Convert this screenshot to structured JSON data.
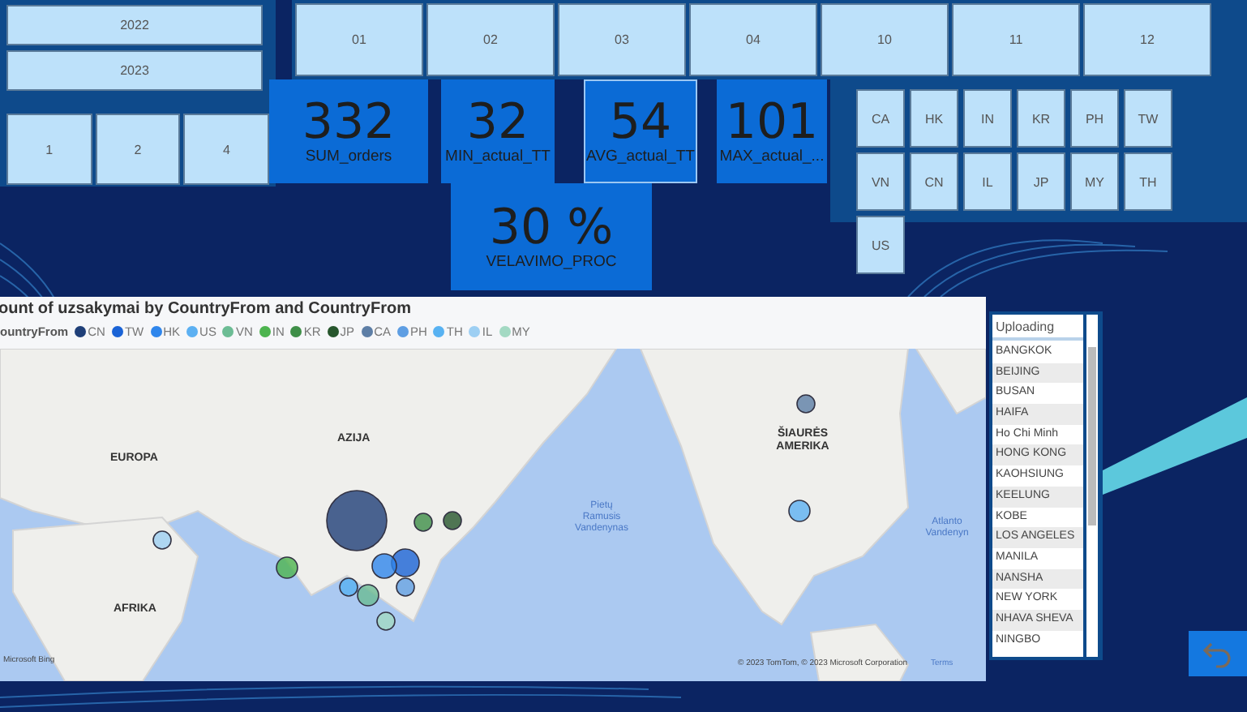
{
  "years": [
    {
      "label": "2022"
    },
    {
      "label": "2023"
    }
  ],
  "quarters": [
    {
      "label": "1"
    },
    {
      "label": "2"
    },
    {
      "label": "4"
    }
  ],
  "months": [
    {
      "label": "01"
    },
    {
      "label": "02"
    },
    {
      "label": "03"
    },
    {
      "label": "04"
    },
    {
      "label": "10"
    },
    {
      "label": "11"
    },
    {
      "label": "12"
    }
  ],
  "kpis": [
    {
      "value": "332",
      "label": "SUM_orders",
      "highlighted": false
    },
    {
      "value": "32",
      "label": "MIN_actual_TT",
      "highlighted": false
    },
    {
      "value": "54",
      "label": "AVG_actual_TT",
      "highlighted": true
    },
    {
      "value": "101",
      "label": "MAX_actual_...",
      "highlighted": false
    }
  ],
  "percent_card": {
    "value": "30 %",
    "label": "VELAVIMO_PROC"
  },
  "countries": [
    {
      "label": "CA"
    },
    {
      "label": "HK"
    },
    {
      "label": "IN"
    },
    {
      "label": "KR"
    },
    {
      "label": "PH"
    },
    {
      "label": "TW"
    },
    {
      "label": "VN"
    },
    {
      "label": "CN"
    },
    {
      "label": "IL"
    },
    {
      "label": "JP"
    },
    {
      "label": "MY"
    },
    {
      "label": "TH"
    },
    {
      "label": "US"
    }
  ],
  "map": {
    "title": "ount of uzsakymai by CountryFrom and CountryFrom",
    "legend_title": "ountryFrom",
    "legend": [
      {
        "name": "CN",
        "color": "#1f3f78"
      },
      {
        "name": "TW",
        "color": "#1a63d6"
      },
      {
        "name": "HK",
        "color": "#2f86ec"
      },
      {
        "name": "US",
        "color": "#5cb0f2"
      },
      {
        "name": "VN",
        "color": "#6cbc94"
      },
      {
        "name": "IN",
        "color": "#4db44f"
      },
      {
        "name": "KR",
        "color": "#3f8f48"
      },
      {
        "name": "JP",
        "color": "#27562d"
      },
      {
        "name": "CA",
        "color": "#5d7ea6"
      },
      {
        "name": "PH",
        "color": "#5e9ee3"
      },
      {
        "name": "TH",
        "color": "#58b2f2"
      },
      {
        "name": "IL",
        "color": "#9dcff3"
      },
      {
        "name": "MY",
        "color": "#a3d9c3"
      }
    ],
    "labels": {
      "asia": "AZIJA",
      "europe": "EUROPA",
      "africa": "AFRIKA",
      "north_america": "ŠIAURĖS AMERIKA",
      "pacific": "Pietų Ramusis Vandenynas",
      "atlantic": "Atlanto Vandenyn"
    },
    "provider": "Microsoft Bing",
    "copyright": "© 2023 TomTom, © 2023 Microsoft Corporation",
    "terms": "Terms"
  },
  "port_list": {
    "header": "Uploading",
    "items": [
      "BANGKOK",
      "BEIJING",
      "BUSAN",
      "HAIFA",
      "Ho Chi Minh",
      "HONG KONG",
      "KAOHSIUNG",
      "KEELUNG",
      "KOBE",
      "LOS ANGELES",
      "MANILA",
      "NANSHA",
      "NEW YORK",
      "NHAVA SHEVA",
      "NINGBO"
    ]
  }
}
